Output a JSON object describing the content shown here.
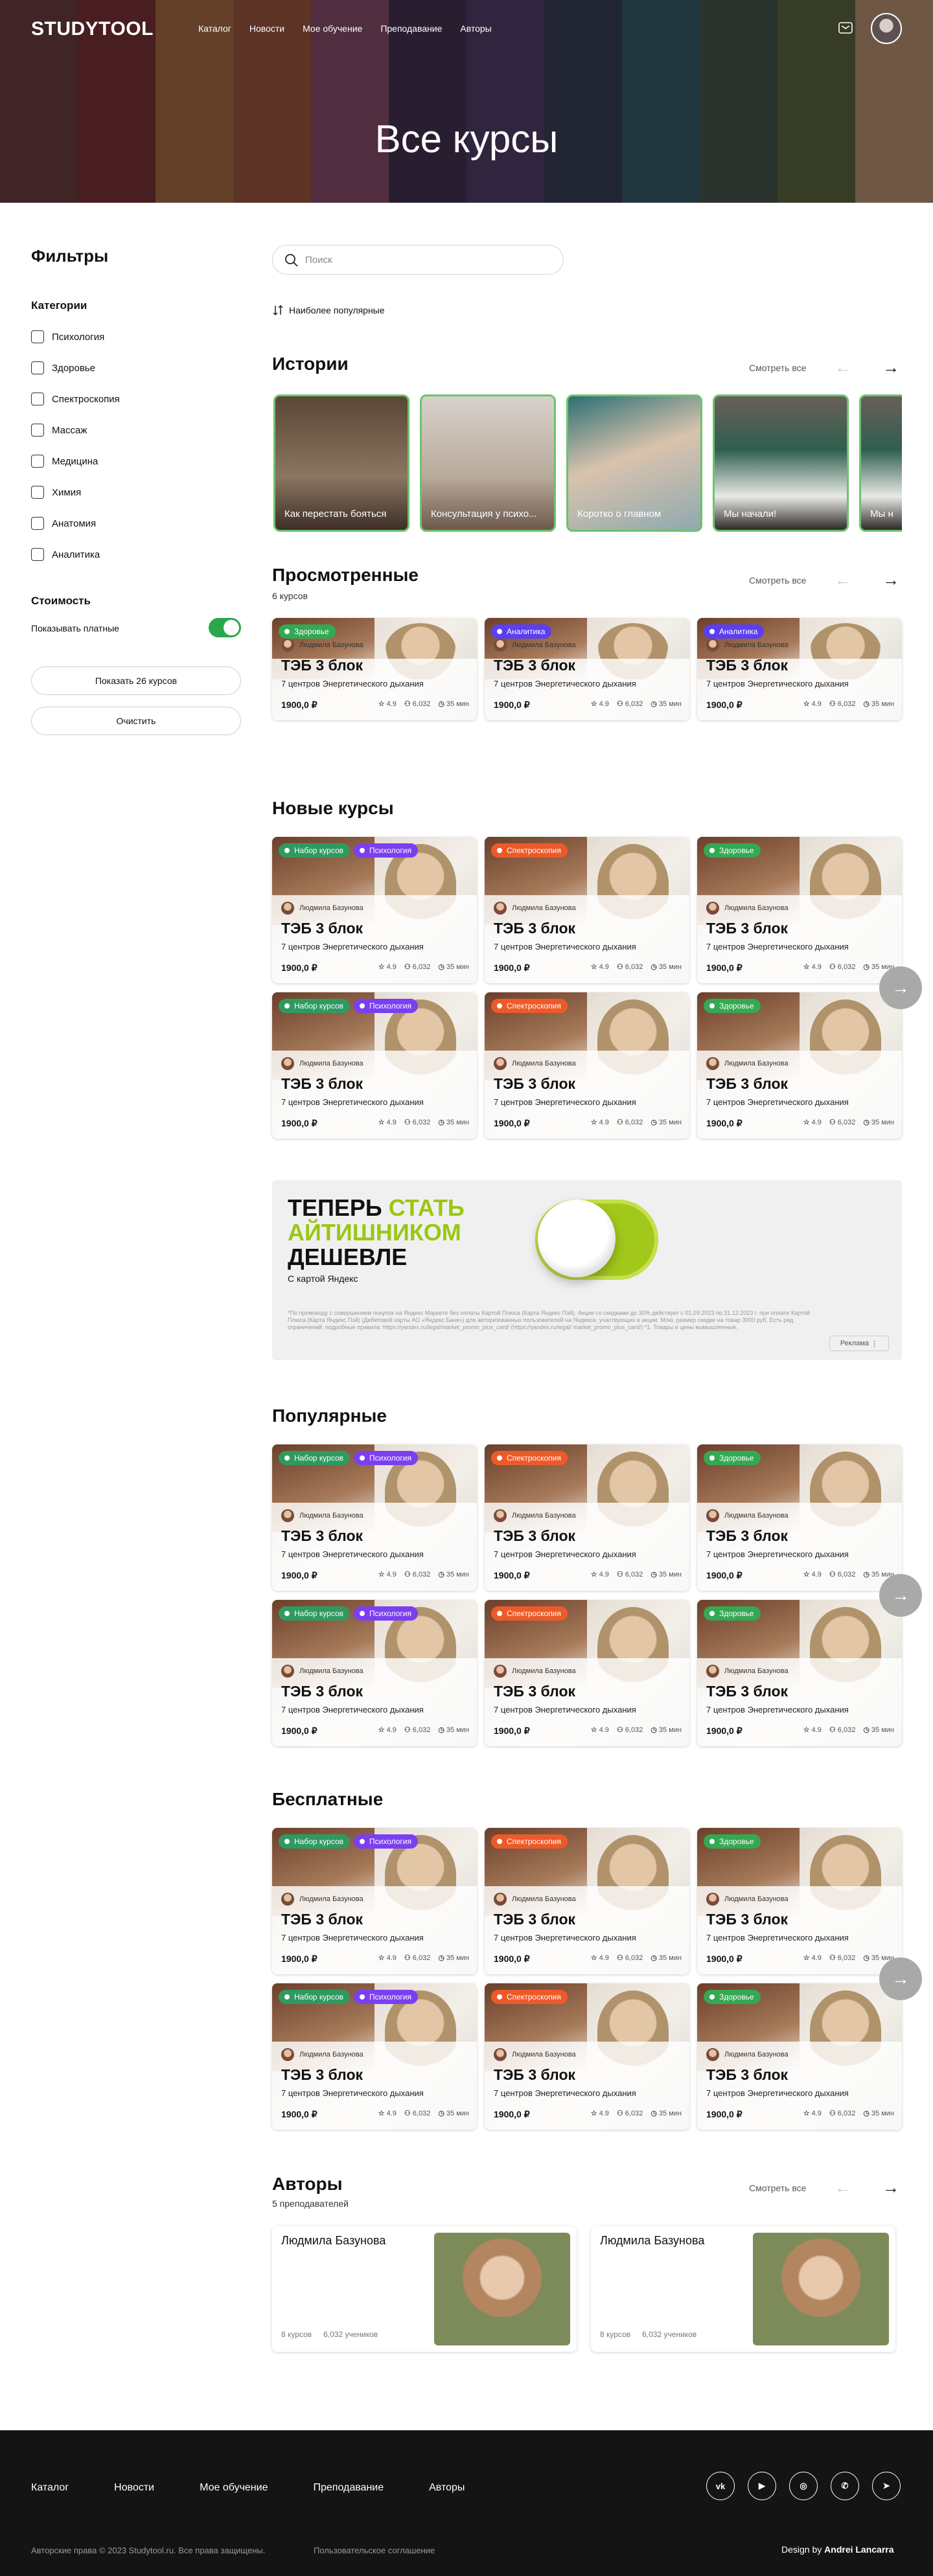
{
  "header": {
    "logo": "STUDYTOOL",
    "nav": [
      "Каталог",
      "Новости",
      "Мое обучение",
      "Преподавание",
      "Авторы"
    ],
    "hero_title": "Все курсы"
  },
  "filters": {
    "title": "Фильтры",
    "categories_title": "Категории",
    "categories": [
      "Психология",
      "Здоровье",
      "Спектроскопия",
      "Массаж",
      "Медицина",
      "Химия",
      "Анатомия",
      "Аналитика"
    ],
    "cost_title": "Стоимость",
    "show_paid": "Показывать платные",
    "show_paid_on": true,
    "show_button": "Показать 26 курсов",
    "clear_button": "Очистить"
  },
  "search": {
    "placeholder": "Поиск"
  },
  "sort": {
    "label": "Наиболее популярные"
  },
  "see_all": "Смотреть все",
  "stories": {
    "title": "Истории",
    "items": [
      "Как перестать бояться",
      "Консультация у психо...",
      "Коротко о главном",
      "Мы начали!",
      "Мы н"
    ]
  },
  "viewed": {
    "title": "Просмотренные",
    "count": "6 курсов"
  },
  "new_courses": {
    "title": "Новые курсы"
  },
  "popular": {
    "title": "Популярные"
  },
  "free": {
    "title": "Бесплатные"
  },
  "course": {
    "author": "Людмила Базунова",
    "title": "ТЭБ 3 блок",
    "subtitle": "7 центров Энергетического дыхания",
    "price": "1900,0 ₽",
    "rating": "4.9",
    "students": "6,032",
    "duration": "35 мин"
  },
  "badges": {
    "set": "Набор курсов",
    "psych": "Психология",
    "spectro": "Спектроскопия",
    "health": "Здоровье",
    "analytics": "Аналитика"
  },
  "colors": {
    "set": "#2f9a60",
    "psych": "#7b3ff2",
    "spectro": "#ec5a2a",
    "health": "#34a853",
    "analytics": "#5b3ff0",
    "toggle": "#2aa84a",
    "footer": "#141414"
  },
  "ad": {
    "line1": "ТЕПЕРЬ",
    "line1_accent": "СТАТЬ",
    "line2": "АЙТИШНИКОМ",
    "line3": "ДЕШЕВЛЕ",
    "card_text": "С картой Яндекс",
    "fine_print": "*По промокоду с совершением покупок на Яндекс Маркете без оплаты Картой Плюса (Карта Яндекс Пэй). Акция со скидками до 30% действует с 01.09.2023 по 31.12.2023 г. при оплате Картой Плюса (Карта Яндекс Пэй) (Дебетовой карты АО «Яндекс Банк») для авторизованных пользователей на Яндексе, участвующих в акции. Мою, размер скидки на товар 3000 руб. Есть ряд ограничений, подробные правила: https://yandex.ru/legal/market_promo_plus_card/ (https://yandex.ru/legal/ market_promo_plus_card/) *1. Товары и цены вымышленные.",
    "label": "Реклама"
  },
  "authors": {
    "title": "Авторы",
    "count": "5 преподавателей",
    "items": [
      {
        "name": "Людмила Базунова",
        "courses": "8 курсов",
        "students": "6,032 учеников"
      },
      {
        "name": "Людмила Базунова",
        "courses": "8 курсов",
        "students": "6,032 учеников"
      }
    ]
  },
  "footer": {
    "nav": [
      "Каталог",
      "Новости",
      "Мое обучение",
      "Преподавание",
      "Авторы"
    ],
    "social": [
      "vk-icon",
      "youtube-icon",
      "instagram-icon",
      "whatsapp-icon",
      "telegram-icon"
    ],
    "copyright": "Авторские права © 2023 Studytool.ru. Все права защищены.",
    "terms": "Пользовательское соглашение",
    "design_prefix": "Design by",
    "design_name": "Andrei Lancarra"
  }
}
